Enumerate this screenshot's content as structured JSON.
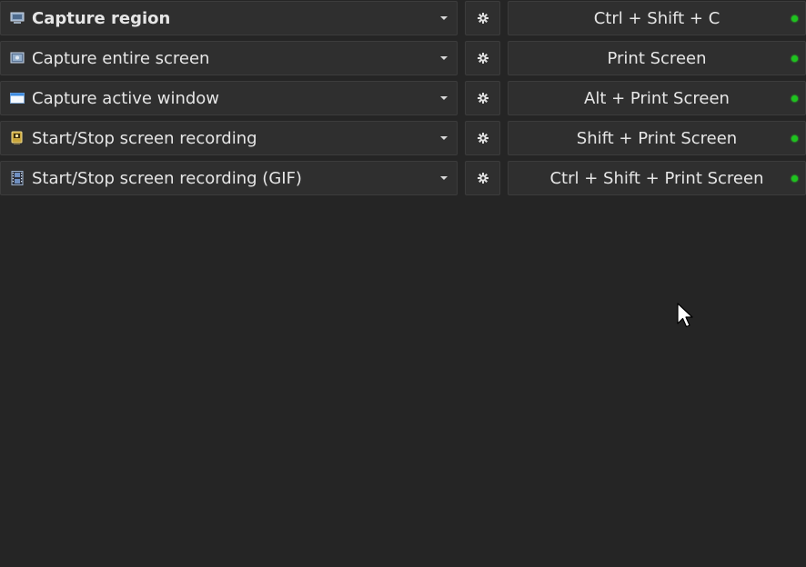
{
  "hotkeys": [
    {
      "task": "Capture region",
      "icon": "capture-region-icon",
      "bold": true,
      "hotkey": "Ctrl + Shift + C",
      "status_color": "#1ec31e"
    },
    {
      "task": "Capture entire screen",
      "icon": "capture-screen-icon",
      "bold": false,
      "hotkey": "Print Screen",
      "status_color": "#1ec31e"
    },
    {
      "task": "Capture active window",
      "icon": "capture-window-icon",
      "bold": false,
      "hotkey": "Alt + Print Screen",
      "status_color": "#1ec31e"
    },
    {
      "task": "Start/Stop screen recording",
      "icon": "screen-recording-icon",
      "bold": false,
      "hotkey": "Shift + Print Screen",
      "status_color": "#1ec31e"
    },
    {
      "task": "Start/Stop screen recording (GIF)",
      "icon": "gif-recording-icon",
      "bold": false,
      "hotkey": "Ctrl + Shift + Print Screen",
      "status_color": "#1ec31e"
    }
  ],
  "icons": {
    "settings": "gear-icon",
    "dropdown": "chevron-down-icon",
    "status": "status-dot-icon",
    "cursor": "mouse-pointer-icon"
  }
}
